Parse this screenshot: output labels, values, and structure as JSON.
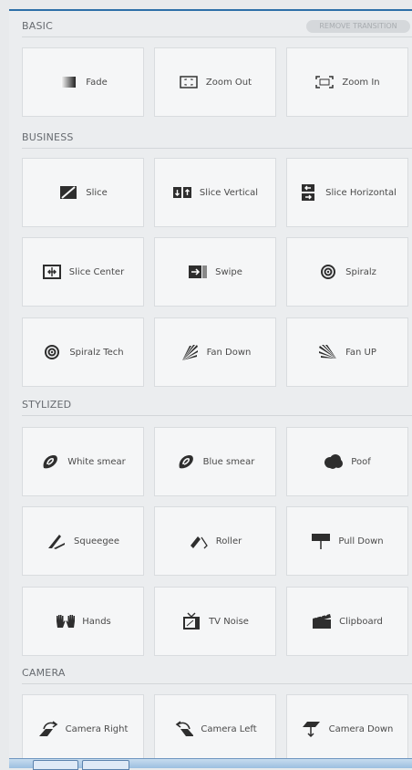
{
  "header": {
    "remove_label": "REMOVE TRANSITION"
  },
  "sections": [
    {
      "title": "BASIC",
      "tiles": [
        {
          "label": "Fade",
          "icon": "fade-icon"
        },
        {
          "label": "Zoom Out",
          "icon": "zoom-out-icon"
        },
        {
          "label": "Zoom In",
          "icon": "zoom-in-icon"
        }
      ]
    },
    {
      "title": "BUSINESS",
      "tiles": [
        {
          "label": "Slice",
          "icon": "slice-icon"
        },
        {
          "label": "Slice Vertical",
          "icon": "slice-vertical-icon"
        },
        {
          "label": "Slice Horizontal",
          "icon": "slice-horizontal-icon"
        },
        {
          "label": "Slice Center",
          "icon": "slice-center-icon"
        },
        {
          "label": "Swipe",
          "icon": "swipe-icon"
        },
        {
          "label": "Spiralz",
          "icon": "spiral-icon"
        },
        {
          "label": "Spiralz Tech",
          "icon": "spiral-tech-icon"
        },
        {
          "label": "Fan Down",
          "icon": "fan-down-icon"
        },
        {
          "label": "Fan UP",
          "icon": "fan-up-icon"
        }
      ]
    },
    {
      "title": "STYLIZED",
      "tiles": [
        {
          "label": "White smear",
          "icon": "white-smear-icon"
        },
        {
          "label": "Blue smear",
          "icon": "blue-smear-icon"
        },
        {
          "label": "Poof",
          "icon": "poof-icon"
        },
        {
          "label": "Squeegee",
          "icon": "squeegee-icon"
        },
        {
          "label": "Roller",
          "icon": "roller-icon"
        },
        {
          "label": "Pull Down",
          "icon": "pull-down-icon"
        },
        {
          "label": "Hands",
          "icon": "hands-icon"
        },
        {
          "label": "TV Noise",
          "icon": "tv-noise-icon"
        },
        {
          "label": "Clipboard",
          "icon": "clipboard-icon"
        }
      ]
    },
    {
      "title": "CAMERA",
      "tiles": [
        {
          "label": "Camera Right",
          "icon": "camera-right-icon"
        },
        {
          "label": "Camera Left",
          "icon": "camera-left-icon"
        },
        {
          "label": "Camera Down",
          "icon": "camera-down-icon"
        }
      ]
    }
  ]
}
